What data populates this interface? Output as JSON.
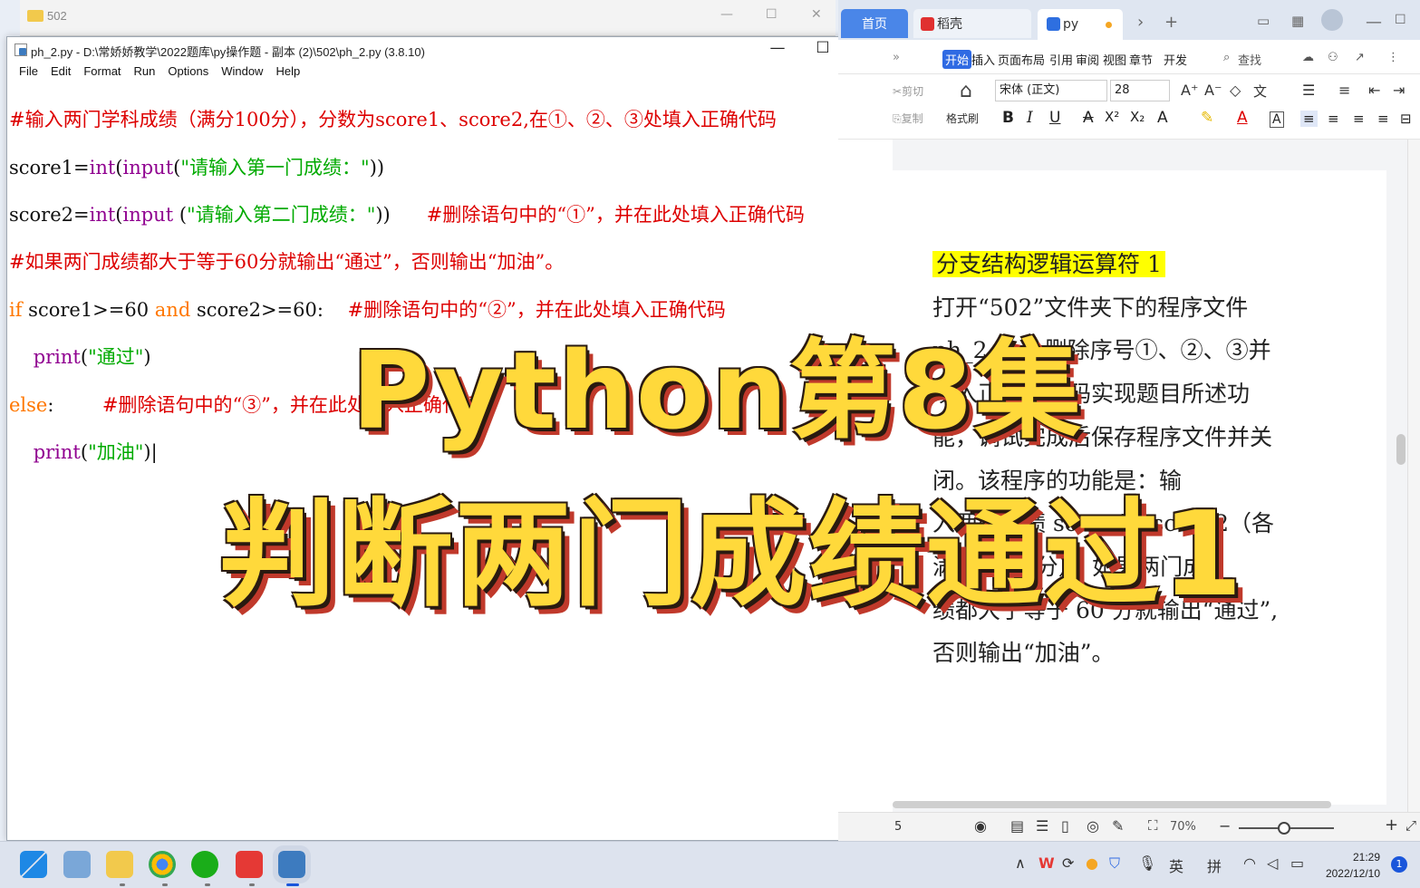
{
  "explorer": {
    "title": "502",
    "minimize": "—",
    "maximize": "☐",
    "close": "✕"
  },
  "idle": {
    "title": "ph_2.py - D:\\常娇娇教学\\2022题库\\py操作题 - 副本 (2)\\502\\ph_2.py (3.8.10)",
    "minimize": "—",
    "maximize": "☐",
    "close": "✕",
    "menu": [
      "File",
      "Edit",
      "Format",
      "Run",
      "Options",
      "Window",
      "Help"
    ],
    "code": {
      "l1": "#输入两门学科成绩（满分100分），分数为score1、score2,在①、②、③处填入正确代码",
      "l2_a": "score1=",
      "l2_b": "int",
      "l2_c": "(",
      "l2_d": "input",
      "l2_e": "(",
      "l2_f": "\"请输入第一门成绩：\"",
      "l2_g": "))",
      "l3_a": "score2=",
      "l3_b": "int",
      "l3_c": "(",
      "l3_d": "input",
      "l3_e": " (",
      "l3_f": "\"请输入第二门成绩：\"",
      "l3_g": "))",
      "l3_h": "      #删除语句中的“①”，并在此处填入正确代码",
      "l4": "#如果两门成绩都大于等于60分就输出“通过”，否则输出“加油”。",
      "l5_a": "if",
      "l5_b": " score1>=60 ",
      "l5_c": "and",
      "l5_d": " score2>=60:    ",
      "l5_e": "#删除语句中的“②”，并在此处填入正确代码",
      "l6_a": "    ",
      "l6_b": "print",
      "l6_c": "(",
      "l6_d": "\"通过\"",
      "l6_e": ")",
      "l7_a": "else",
      "l7_b": ":        ",
      "l7_c": "#删除语句中的“③”，并在此处填入正确代码",
      "l8_a": "    ",
      "l8_b": "print",
      "l8_c": "(",
      "l8_d": "\"加油\"",
      "l8_e": ")|"
    }
  },
  "wps": {
    "tabs": {
      "home": "首页",
      "daoke": "稻壳",
      "doc": "py"
    },
    "ribbon_tabs": [
      "开始",
      "插入",
      "页面布局",
      "引用",
      "审阅",
      "视图",
      "章节",
      "开发"
    ],
    "search_label": "查找",
    "cut": "剪切",
    "copy": "复制",
    "format_painter": "格式刷",
    "font_name": "宋体 (正文)",
    "font_size": "28",
    "doc_lines": [
      "分支结构逻辑运算符 1",
      "打开“502”文件夹下的程序文件",
      "ph_2.py，删除序号①、②、③并",
      "填入正确的代码实现题目所述功",
      "能，调试完成后保存程序文件并关",
      "闭。该程序的功能是：输",
      "入两门成绩 score1、score2（各",
      "满分 100 分），如果两门成",
      "绩都大于等于 60 分就输出“通过”,",
      "否则输出“加油”。"
    ],
    "status_page": "5",
    "zoom": "70%",
    "zoom_level": 0.45
  },
  "overlay": {
    "line1": "Python第8集",
    "line2": "判断两门成绩通过1"
  },
  "taskbar": {
    "ime1": "英",
    "ime2": "拼",
    "time": "21:29",
    "date": "2022/12/10",
    "notifications": "1"
  },
  "colors": {
    "accent": "#2f6ae3",
    "title_yellow": "#ffd93b",
    "title_shadow": "#c0392b",
    "highlight": "#ffff00"
  }
}
